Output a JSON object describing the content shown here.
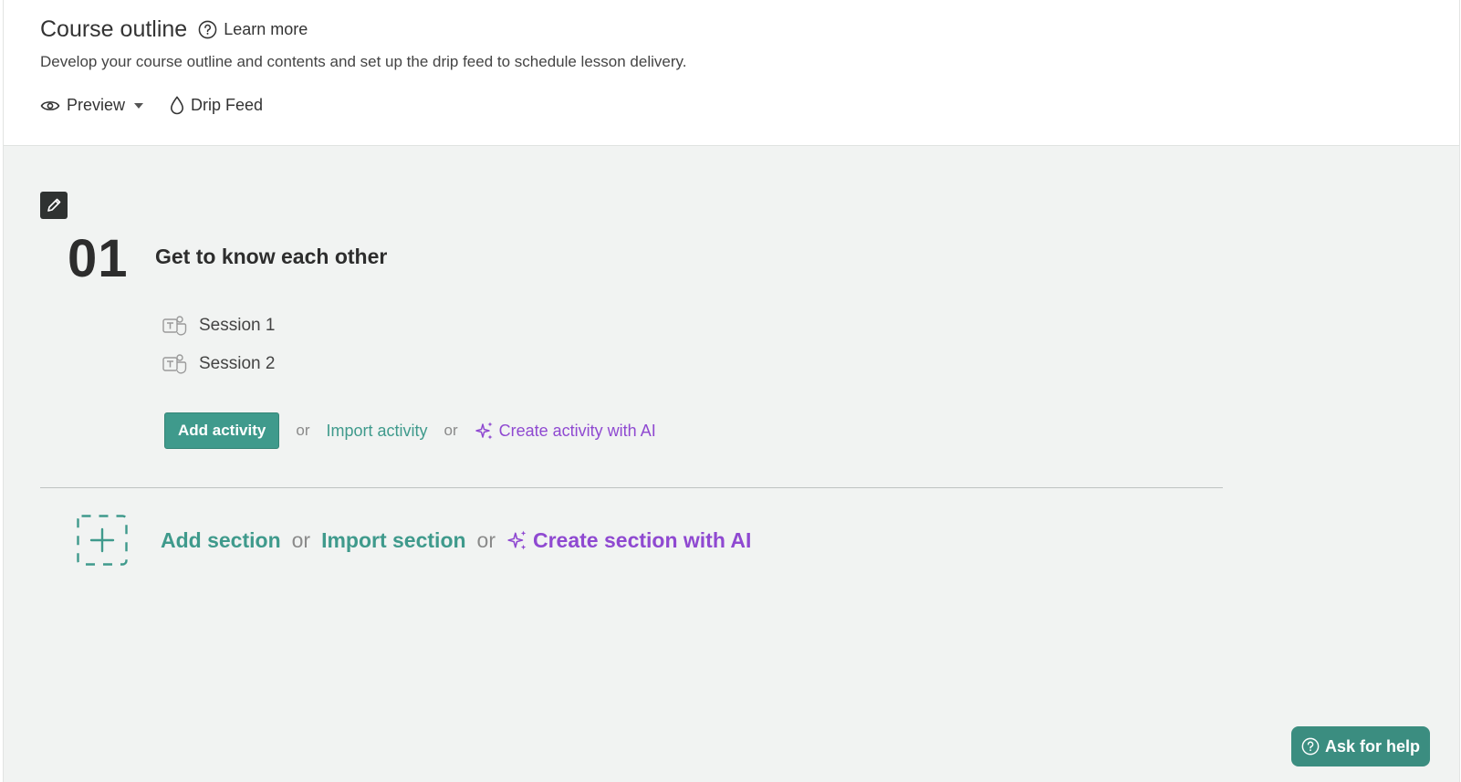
{
  "header": {
    "title": "Course outline",
    "learn_more": "Learn more",
    "subtitle": "Develop your course outline and contents and set up the drip feed to schedule lesson delivery.",
    "toolbar": {
      "preview": "Preview",
      "drip_feed": "Drip Feed"
    }
  },
  "section": {
    "number": "01",
    "title": "Get to know each other",
    "activities": [
      {
        "label": "Session 1",
        "icon": "teams-icon"
      },
      {
        "label": "Session 2",
        "icon": "teams-icon"
      }
    ],
    "add_activity": "Add activity",
    "or1": "or",
    "import_activity": "Import activity",
    "or2": "or",
    "create_activity_ai": "Create activity with AI"
  },
  "add_section": {
    "add": "Add section",
    "or1": "or",
    "import": "Import section",
    "or2": "or",
    "create_ai": "Create section with AI"
  },
  "help": {
    "label": "Ask for help"
  },
  "colors": {
    "teal": "#3f9a8c",
    "purple": "#8f49d1",
    "background": "#f1f3f2"
  }
}
